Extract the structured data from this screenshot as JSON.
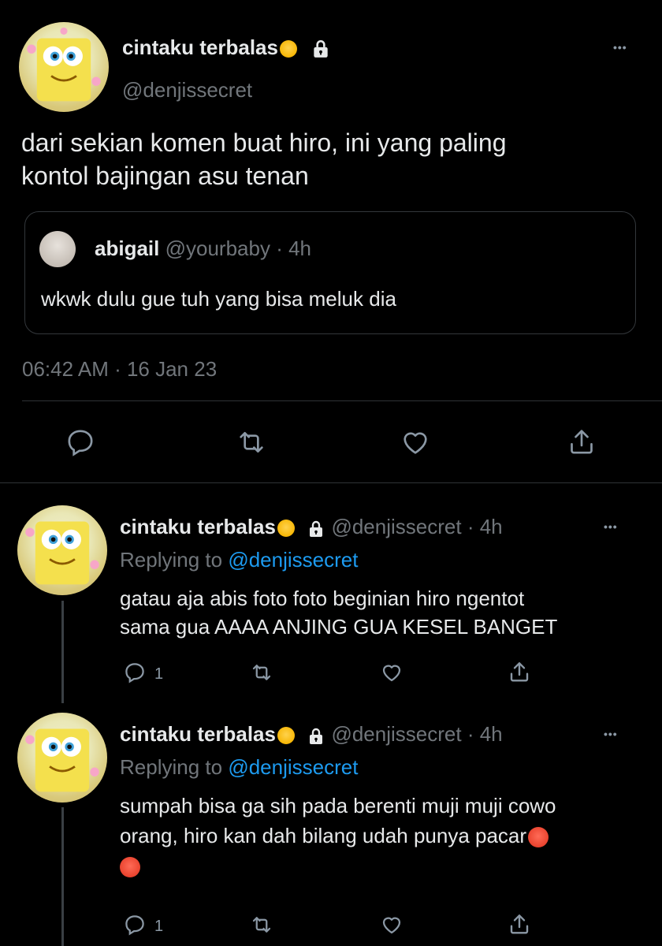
{
  "main_tweet": {
    "display_name": "cintaku terbalas",
    "handle": "@denjissecret",
    "text_line1": "dari sekian komen buat hiro, ini yang paling",
    "text_line2": "kontol bajingan asu tenan",
    "timestamp": "06:42 AM · 16 Jan 23",
    "more_label": "•••"
  },
  "quoted_tweet": {
    "display_name": "abigail",
    "handle": "@yourbaby",
    "time": "· 4h",
    "text": "wkwk dulu gue tuh yang bisa meluk dia"
  },
  "replies": [
    {
      "display_name": "cintaku terbalas",
      "handle": "@denjissecret",
      "time": "· 4h",
      "replying_label": "Replying to",
      "replying_handle": "@denjissecret",
      "text_line1": "gatau aja abis foto foto beginian hiro ngentot",
      "text_line2": "sama gua AAAA ANJING GUA KESEL BANGET",
      "reply_count": "1",
      "more_label": "•••"
    },
    {
      "display_name": "cintaku terbalas",
      "handle": "@denjissecret",
      "time": "· 4h",
      "replying_label": "Replying to",
      "replying_handle": "@denjissecret",
      "text_line1": "sumpah bisa ga sih pada berenti muji muji cowo",
      "text_line2": "orang, hiro kan dah bilang udah punya pacar",
      "reply_count": "1",
      "more_label": "•••"
    }
  ],
  "icons": [
    "reply-icon",
    "retweet-icon",
    "like-icon",
    "share-icon",
    "lock-icon",
    "more-icon"
  ]
}
